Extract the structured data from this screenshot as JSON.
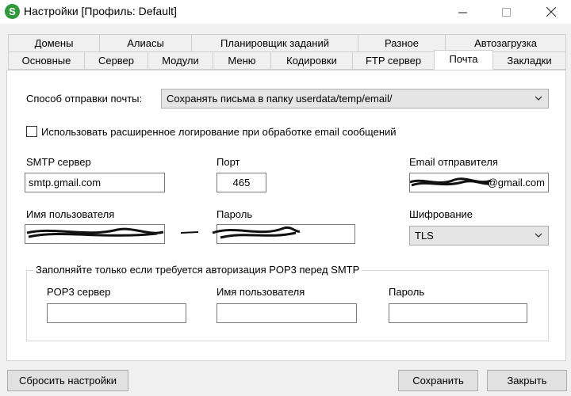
{
  "window": {
    "app_icon_letter": "S",
    "title": "Настройки [Профиль: Default]"
  },
  "tabs_row1": [
    "Домены",
    "Алиасы",
    "Планировщик заданий",
    "Разное",
    "Автозагрузка"
  ],
  "tabs_row2": [
    "Основные",
    "Сервер",
    "Модули",
    "Меню",
    "Кодировки",
    "FTP сервер",
    "Почта",
    "Закладки"
  ],
  "active_tab": "Почта",
  "mail": {
    "send_method_label": "Способ отправки почты:",
    "send_method_value": "Сохранять письма в папку userdata/temp/email/",
    "ext_logging_label": "Использовать расширенное логирование при обработке email сообщений",
    "ext_logging_checked": false,
    "smtp_server_label": "SMTP сервер",
    "smtp_server_value": "smtp.gmail.com",
    "port_label": "Порт",
    "port_value": "465",
    "sender_email_label": "Email отправителя",
    "sender_email_value": "@gmail.com",
    "username_label": "Имя пользователя",
    "username_value": "",
    "password_label": "Пароль",
    "password_value": "",
    "encryption_label": "Шифрование",
    "encryption_value": "TLS",
    "pop3": {
      "group_title": "Заполняйте только если требуется авторизация POP3 перед SMTP",
      "server_label": "POP3 сервер",
      "server_value": "",
      "username_label": "Имя пользователя",
      "username_value": "",
      "password_label": "Пароль",
      "password_value": ""
    }
  },
  "buttons": {
    "reset": "Сбросить настройки",
    "save": "Сохранить",
    "close": "Закрыть"
  }
}
